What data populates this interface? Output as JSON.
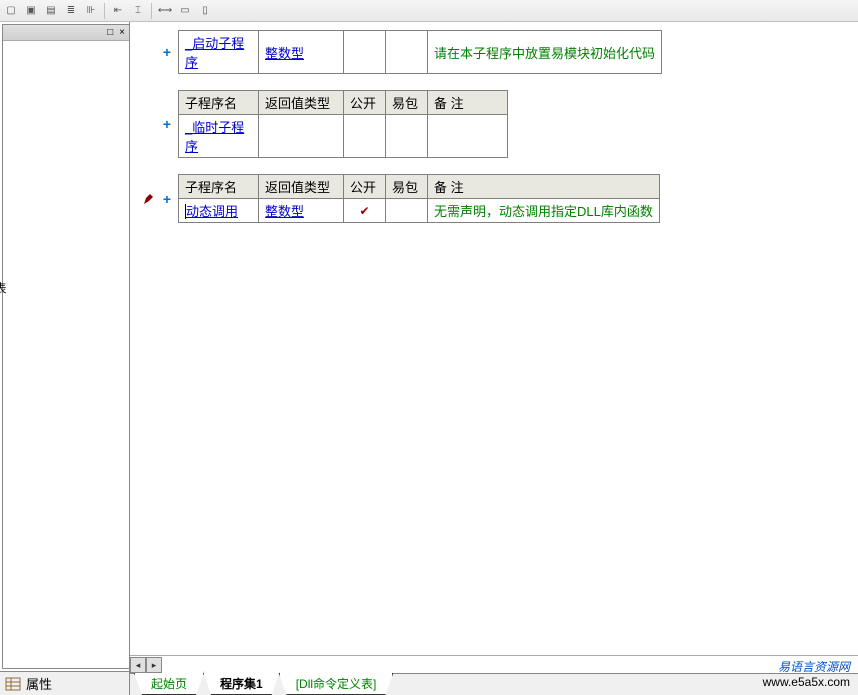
{
  "toolbar": {
    "icons": [
      "□",
      "▣",
      "▤",
      "≡",
      "⊪",
      "⊩",
      "↔",
      "⌶",
      "",
      "⟷",
      "▭",
      "▯"
    ]
  },
  "left_panel": {
    "header_buttons": [
      "□",
      "×"
    ],
    "side_label": "表"
  },
  "properties": {
    "label": "属性"
  },
  "code": {
    "headers": {
      "name": "子程序名",
      "ret": "返回值类型",
      "pub": "公开",
      "pkg": "易包",
      "note": "备 注"
    },
    "block1": {
      "name": "_启动子程序",
      "ret": "整数型",
      "pub": "",
      "pkg": "",
      "note": "请在本子程序中放置易模块初始化代码"
    },
    "block2": {
      "name": "_临时子程序",
      "ret": "",
      "pub": "",
      "pkg": "",
      "note": ""
    },
    "block3": {
      "name": "动态调用",
      "ret": "整数型",
      "pub": "✓",
      "pkg": "",
      "note": "无需声明，动态调用指定DLL库内函数"
    }
  },
  "tabs": {
    "start": "起始页",
    "prog": "程序集1",
    "dll": "[Dll命令定义表]"
  },
  "watermark": {
    "cn": "易语言资源网",
    "en": "www.e5a5x.com"
  }
}
